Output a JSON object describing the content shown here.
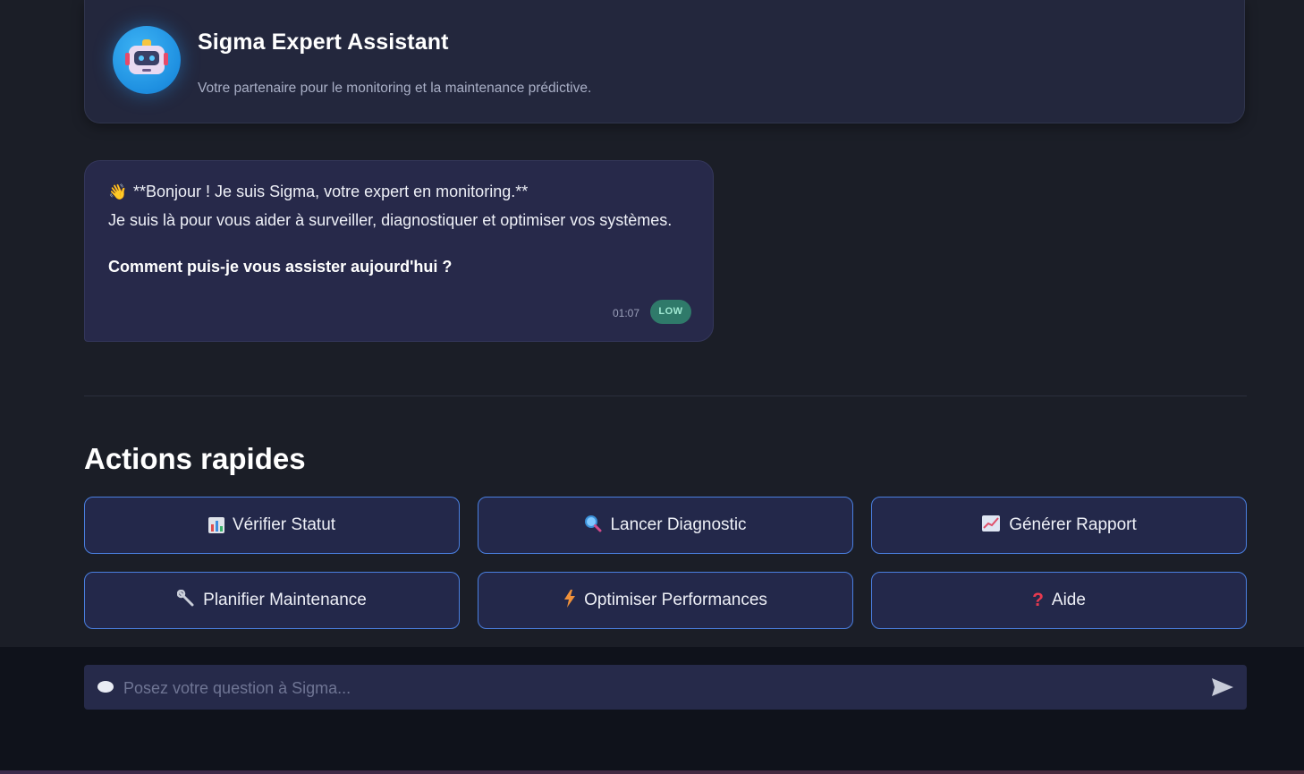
{
  "header": {
    "title": "Sigma Expert Assistant",
    "subtitle": "Votre partenaire pour le monitoring et la maintenance prédictive.",
    "avatar_icon": "robot-icon"
  },
  "message": {
    "wave_icon": "👋",
    "line1": "**Bonjour ! Je suis Sigma, votre expert en monitoring.**",
    "line2": "Je suis là pour vous aider à surveiller, diagnostiquer et optimiser vos systèmes.",
    "line3": "Comment puis-je vous assister aujourd'hui ?",
    "time": "01:07",
    "priority": "LOW"
  },
  "quick_actions": {
    "title": "Actions rapides",
    "buttons": [
      {
        "icon": "bar-chart-icon",
        "label": "Vérifier Statut"
      },
      {
        "icon": "magnifier-icon",
        "label": "Lancer Diagnostic"
      },
      {
        "icon": "trend-chart-icon",
        "label": "Générer Rapport"
      },
      {
        "icon": "wrench-icon",
        "label": "Planifier Maintenance"
      },
      {
        "icon": "lightning-icon",
        "label": "Optimiser Performances"
      },
      {
        "icon": "question-icon",
        "label": "Aide"
      }
    ]
  },
  "chat_input": {
    "placeholder": "Posez votre question à Sigma...",
    "value": ""
  },
  "colors": {
    "accent_border": "#4a7fe0",
    "priority_low": "#2f7a6a",
    "card_bg": "#23273d"
  }
}
